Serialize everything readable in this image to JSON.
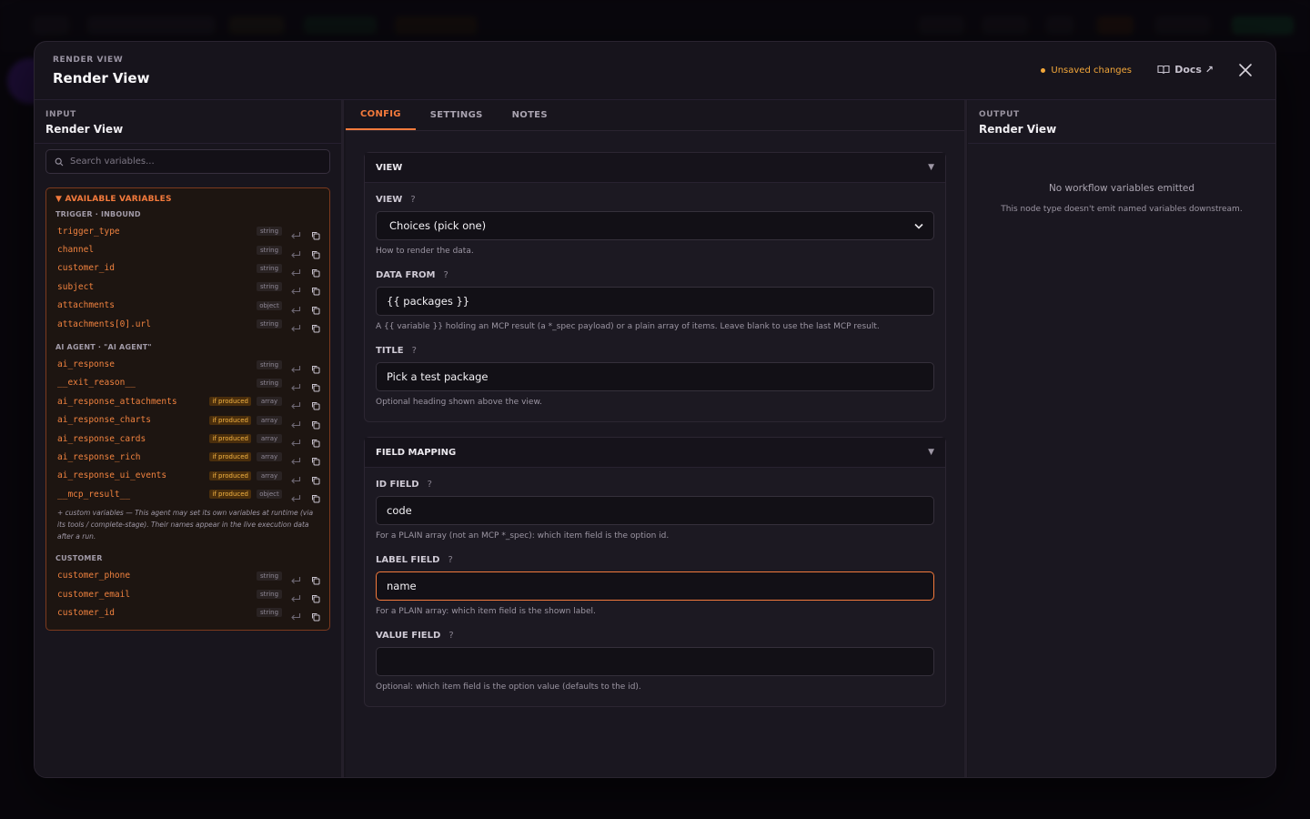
{
  "modal": {
    "eyebrow": "RENDER VIEW",
    "title": "Render View",
    "unsaved": "Unsaved changes",
    "docs": "Docs ↗"
  },
  "input": {
    "label": "INPUT",
    "title": "Render View",
    "search_placeholder": "Search variables...",
    "available_title": "▼ AVAILABLE VARIABLES",
    "groups": [
      {
        "label": "TRIGGER · INBOUND",
        "vars": [
          {
            "name": "trigger_type",
            "type": "string"
          },
          {
            "name": "channel",
            "type": "string"
          },
          {
            "name": "customer_id",
            "type": "string"
          },
          {
            "name": "subject",
            "type": "string"
          },
          {
            "name": "attachments",
            "type": "object"
          },
          {
            "name": "attachments[0].url",
            "type": "string"
          }
        ]
      },
      {
        "label": "AI AGENT · \"AI AGENT\"",
        "vars": [
          {
            "name": "ai_response",
            "type": "string"
          },
          {
            "name": "__exit_reason__",
            "type": "string"
          },
          {
            "name": "ai_response_attachments",
            "type": "array",
            "badge": "if produced"
          },
          {
            "name": "ai_response_charts",
            "type": "array",
            "badge": "if produced"
          },
          {
            "name": "ai_response_cards",
            "type": "array",
            "badge": "if produced"
          },
          {
            "name": "ai_response_rich",
            "type": "array",
            "badge": "if produced"
          },
          {
            "name": "ai_response_ui_events",
            "type": "array",
            "badge": "if produced"
          },
          {
            "name": "__mcp_result__",
            "type": "object",
            "badge": "if produced"
          }
        ],
        "note": "+ custom variables — This agent may set its own variables at runtime (via its tools / complete-stage). Their names appear in the live execution data after a run."
      },
      {
        "label": "CUSTOMER",
        "vars": [
          {
            "name": "customer_phone",
            "type": "string"
          },
          {
            "name": "customer_email",
            "type": "string"
          },
          {
            "name": "customer_id",
            "type": "string"
          }
        ]
      }
    ]
  },
  "tabs": [
    "CONFIG",
    "SETTINGS",
    "NOTES"
  ],
  "view_card": {
    "title": "VIEW",
    "view_label": "VIEW",
    "view_value": "Choices (pick one)",
    "view_help": "How to render the data.",
    "data_from_label": "DATA FROM",
    "data_from_value": "{{ packages }}",
    "data_from_help": "A {{ variable }} holding an MCP result (a *_spec payload) or a plain array of items. Leave blank to use the last MCP result.",
    "title_label": "TITLE",
    "title_value": "Pick a test package",
    "title_help": "Optional heading shown above the view."
  },
  "mapping_card": {
    "title": "FIELD MAPPING",
    "id_label": "ID FIELD",
    "id_value": "code",
    "id_help": "For a PLAIN array (not an MCP *_spec): which item field is the option id.",
    "label_label": "LABEL FIELD",
    "label_value": "name",
    "label_help": "For a PLAIN array: which item field is the shown label.",
    "value_label": "VALUE FIELD",
    "value_value": "",
    "value_help": "Optional: which item field is the option value (defaults to the id)."
  },
  "output": {
    "label": "OUTPUT",
    "title": "Render View",
    "empty_title": "No workflow variables emitted",
    "empty_sub": "This node type doesn't emit named variables downstream."
  },
  "colors": {
    "accent": "#f47a3c",
    "warning": "#f3a73a"
  }
}
